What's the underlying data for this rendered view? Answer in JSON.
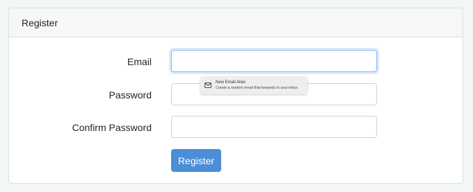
{
  "card": {
    "header_title": "Register"
  },
  "form": {
    "email_label": "Email",
    "email_value": "",
    "password_label": "Password",
    "password_value": "",
    "confirm_label": "Confirm Password",
    "confirm_value": "",
    "submit_label": "Register"
  },
  "autofill_popup": {
    "icon": "mail-icon",
    "title": "New Email Alias",
    "description": "Create a random email that forwards to your inbox."
  },
  "colors": {
    "button": "#4b8ed6",
    "focus_border": "#89b8e8",
    "page_background": "#f2f7f6"
  }
}
